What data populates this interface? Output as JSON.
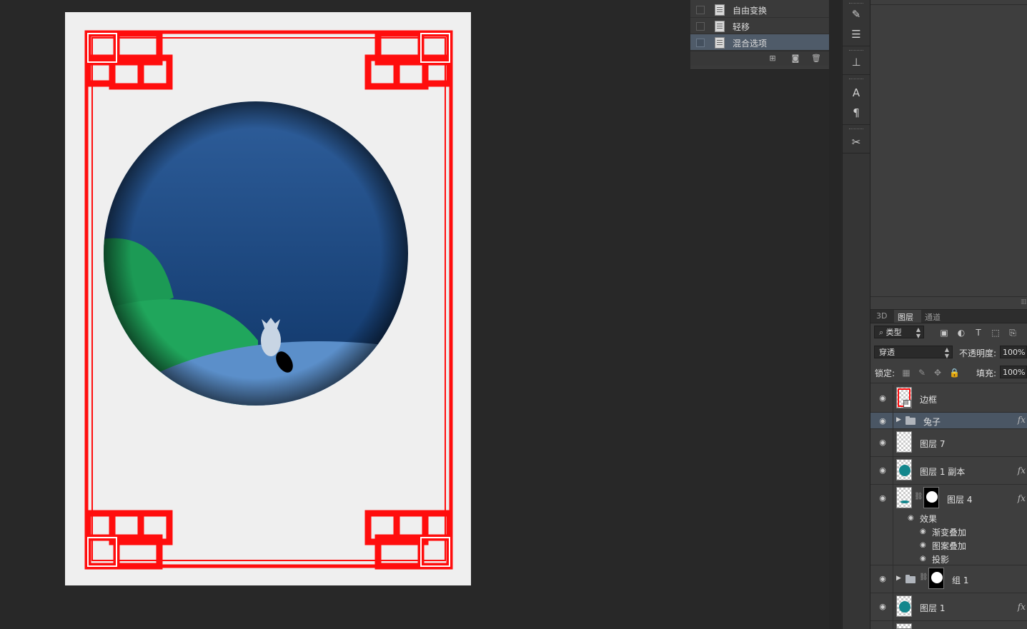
{
  "history": {
    "items": [
      {
        "label": "自由变换",
        "selected": false
      },
      {
        "label": "轻移",
        "selected": false
      },
      {
        "label": "混合选项",
        "selected": true
      }
    ],
    "footer_icons": [
      "new-document-from-state-icon",
      "camera-snapshot-icon",
      "trash-icon"
    ]
  },
  "toolstrip": {
    "icons": [
      "brushes-icon",
      "adjust-sliders-icon",
      "clone-stamp-icon",
      "character-icon",
      "paragraph-icon",
      "tool-presets-icon"
    ]
  },
  "layers_panel": {
    "tabs": [
      {
        "label": "3D",
        "active": false
      },
      {
        "label": "图层",
        "active": true
      },
      {
        "label": "通道",
        "active": false
      }
    ],
    "filter_kind": "类型",
    "blend_mode": "穿透",
    "opacity_label": "不透明度:",
    "opacity_value": "100%",
    "lock_label": "锁定:",
    "fill_label": "填充:",
    "fill_value": "100%",
    "layers": [
      {
        "name": "边框",
        "type": "smart",
        "fx": false,
        "selected": false
      },
      {
        "name": "兔子",
        "type": "group",
        "fx": true,
        "selected": true
      },
      {
        "name": "图层 7",
        "type": "empty",
        "fx": false,
        "selected": false
      },
      {
        "name": "图层 1 副本",
        "type": "teal",
        "fx": true,
        "selected": false
      },
      {
        "name": "图层 4",
        "type": "masked",
        "fx": true,
        "selected": false
      },
      {
        "name": "组 1",
        "type": "group-masked",
        "fx": false,
        "selected": false
      },
      {
        "name": "图层 1",
        "type": "teal",
        "fx": true,
        "selected": false
      }
    ],
    "effects_label": "效果",
    "effects": [
      "渐变叠加",
      "图案叠加",
      "投影"
    ],
    "fx_label": "fx"
  },
  "colors": {
    "frame_red": "#ff0d0d",
    "sky_top": "#2b5a95",
    "sky_bottom": "#0f3668",
    "hill_green": "#1f9a56",
    "ground_blue": "#5a8fca",
    "paper": "#efefef",
    "selected_row": "#4a5664"
  }
}
